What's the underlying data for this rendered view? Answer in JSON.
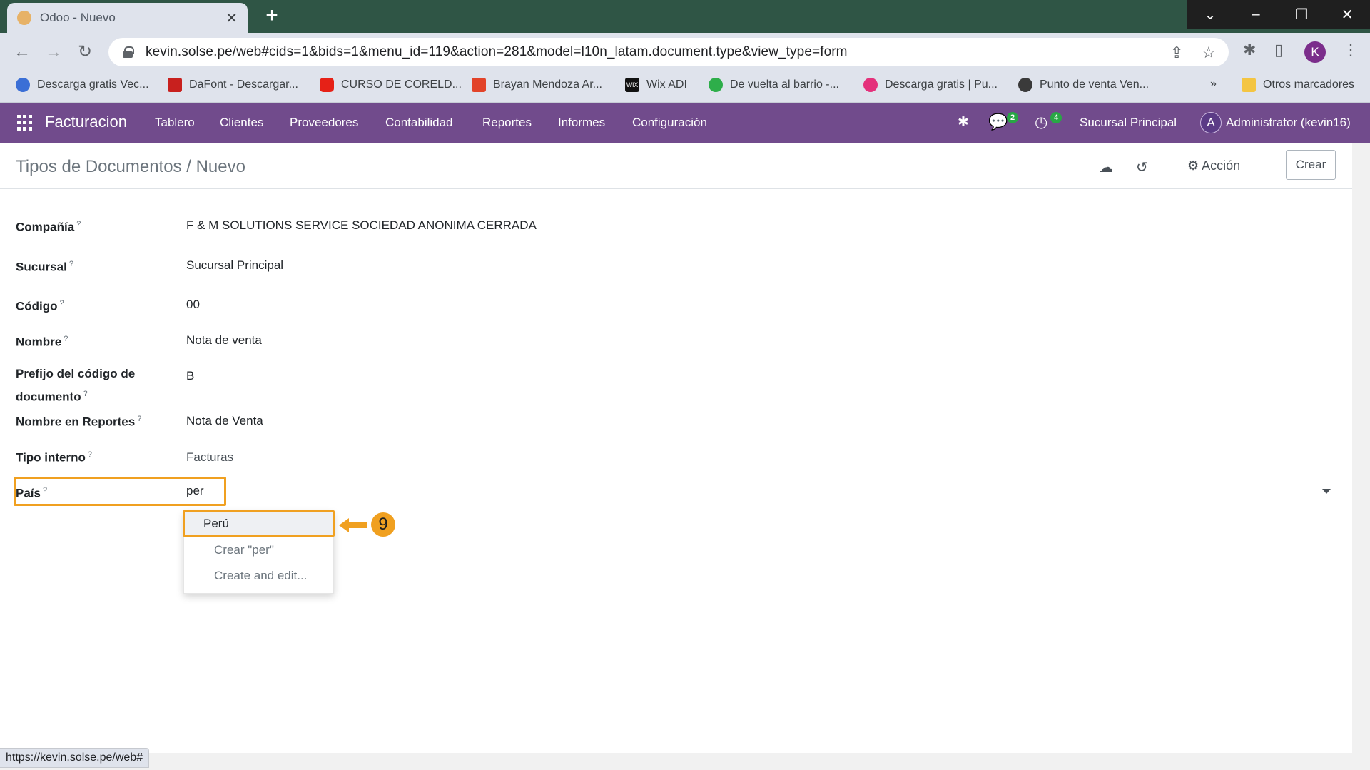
{
  "browser": {
    "tab_title": "Odoo - Nuevo",
    "url": "kevin.solse.pe/web#cids=1&bids=1&menu_id=119&action=281&model=l10n_latam.document.type&view_type=form",
    "profile_initial": "K",
    "bookmarks": [
      "Descarga gratis Vec...",
      "DaFont - Descargar...",
      "CURSO DE CORELD...",
      "Brayan Mendoza Ar...",
      "Wix ADI",
      "De vuelta al barrio -...",
      "Descarga gratis | Pu...",
      "Punto de venta Ven..."
    ],
    "bookmarks_overflow": "»",
    "other_bookmarks": "Otros marcadores",
    "status_url": "https://kevin.solse.pe/web#"
  },
  "navbar": {
    "app_name": "Facturacion",
    "menu": [
      "Tablero",
      "Clientes",
      "Proveedores",
      "Contabilidad",
      "Reportes",
      "Informes",
      "Configuración"
    ],
    "messages_count": "2",
    "activities_count": "4",
    "branch": "Sucursal Principal",
    "user_initial": "A",
    "user": "Administrator (kevin16)"
  },
  "control_panel": {
    "breadcrumb": "Tipos de Documentos / Nuevo",
    "action_label": "Acción",
    "create_label": "Crear"
  },
  "form": {
    "fields": [
      {
        "label": "Compañía",
        "value": "F & M SOLUTIONS SERVICE SOCIEDAD ANONIMA CERRADA"
      },
      {
        "label": "Sucursal",
        "value": "Sucursal Principal"
      },
      {
        "label": "Código",
        "value": "00"
      },
      {
        "label": "Nombre",
        "value": "Nota de venta"
      },
      {
        "label_line1": "Prefijo del código de",
        "label_line2": "documento",
        "value": "B"
      },
      {
        "label": "Nombre en Reportes",
        "value": "Nota de Venta"
      },
      {
        "label": "Tipo interno",
        "value": "Facturas"
      },
      {
        "label": "País",
        "value": "per"
      }
    ],
    "help_mark": "?"
  },
  "autocomplete": {
    "options": [
      "Perú",
      "Crear \"per\"",
      "Create and edit..."
    ]
  },
  "annotation": {
    "step": "9",
    "color": "#f0a020"
  },
  "colors": {
    "odoo_purple": "#714b8c",
    "browser_frame": "#2f5545"
  }
}
